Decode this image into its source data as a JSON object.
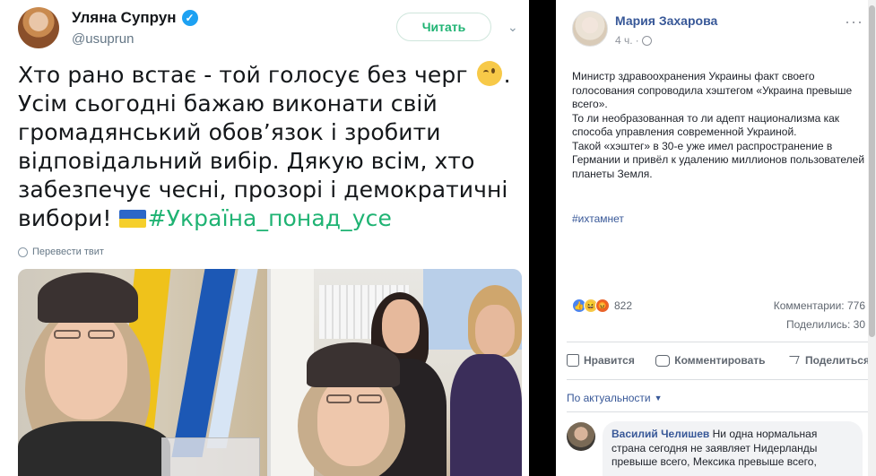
{
  "tweet": {
    "name": "Уляна Супрун",
    "handle": "@usuprun",
    "follow_label": "Читать",
    "text_lines": [
      "Хто рано встає - той голосує без черг",
      "Усім сьогодні бажаю виконати свій",
      "громадянський обов’язок і зробити",
      "відповідальний вибір. Дякую всім, хто",
      "забезпечує чесні, прозорі і демократичні",
      "вибори!"
    ],
    "line1_end": ".",
    "hashtag": "#Україна_понад_усе",
    "translate_label": "Перевести твит",
    "accent_color": "#1fb373"
  },
  "fb_post": {
    "author": "Мария Захарова",
    "time": "4 ч.",
    "body": "Министр здравоохранения Украины факт своего голосования сопроводила хэштегом «Украина превыше всего».\nТо ли необразованная то ли адепт национализма как способа управления современной Украиной.\nТакой «хэштег» в 30-е уже имел распространение в Германии и привёл к удалению миллионов пользователей планеты Земля.",
    "hashtag": "#ихтамнет",
    "reactions_count": "822",
    "comments_count": "Комментарии: 776",
    "shares_count": "Поделились: 30",
    "actions": {
      "like": "Нравится",
      "comment": "Комментировать",
      "share": "Поделиться"
    },
    "sort_label": "По актуальности",
    "comment": {
      "author": "Василий Челишев",
      "text": "Ни одна нормальная страна сегодня не заявляет Нидерланды превыше всего, Мексика превыше всего,"
    },
    "link_color": "#385898"
  }
}
